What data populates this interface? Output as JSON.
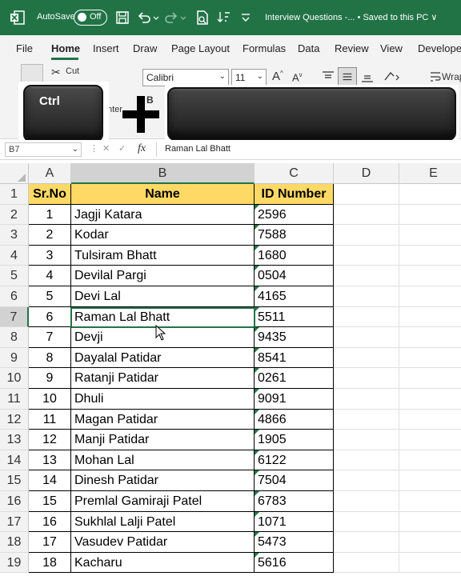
{
  "titlebar": {
    "autosave_label": "AutoSave",
    "autosave_state": "Off",
    "doc_title": "Interview Questions -... • Saved to this PC ∨"
  },
  "tabs": [
    "File",
    "Home",
    "Insert",
    "Draw",
    "Page Layout",
    "Formulas",
    "Data",
    "Review",
    "View",
    "Developer"
  ],
  "active_tab": "Home",
  "ribbon": {
    "cut_label": "Cut",
    "font_name": "Calibri",
    "font_size": "11",
    "grow_font": "A",
    "shrink_font": "A",
    "bold": "B",
    "format_painter_fragment": "nter",
    "wrap_label": "Wrap"
  },
  "keys": {
    "ctrl_label": "Ctrl"
  },
  "formula_bar": {
    "name_box": "B7",
    "fx": "fx",
    "content": "Raman Lal Bhatt"
  },
  "columns": [
    "A",
    "B",
    "C",
    "D",
    "E"
  ],
  "header": {
    "sr": "Sr.No",
    "name": "Name",
    "id": "ID Number"
  },
  "rows": [
    {
      "n": "2",
      "sr": "1",
      "name": "Jagji Katara",
      "id": "2596"
    },
    {
      "n": "3",
      "sr": "2",
      "name": "Kodar",
      "id": "7588"
    },
    {
      "n": "4",
      "sr": "3",
      "name": "Tulsiram Bhatt",
      "id": "1680"
    },
    {
      "n": "5",
      "sr": "4",
      "name": "Devilal Pargi",
      "id": "0504"
    },
    {
      "n": "6",
      "sr": "5",
      "name": "Devi Lal",
      "id": "4165"
    },
    {
      "n": "7",
      "sr": "6",
      "name": "Raman Lal Bhatt",
      "id": "5511"
    },
    {
      "n": "8",
      "sr": "7",
      "name": "Devji",
      "id": "9435"
    },
    {
      "n": "9",
      "sr": "8",
      "name": "Dayalal Patidar",
      "id": "8541"
    },
    {
      "n": "10",
      "sr": "9",
      "name": "Ratanji Patidar",
      "id": "0261"
    },
    {
      "n": "11",
      "sr": "10",
      "name": "Dhuli",
      "id": "9091"
    },
    {
      "n": "12",
      "sr": "11",
      "name": "Magan Patidar",
      "id": "4866"
    },
    {
      "n": "13",
      "sr": "12",
      "name": "Manji Patidar",
      "id": "1905"
    },
    {
      "n": "14",
      "sr": "13",
      "name": "Mohan Lal",
      "id": "6122"
    },
    {
      "n": "15",
      "sr": "14",
      "name": "Dinesh Patidar",
      "id": "7504"
    },
    {
      "n": "16",
      "sr": "15",
      "name": "Premlal Gamiraji Patel",
      "id": "6783"
    },
    {
      "n": "17",
      "sr": "16",
      "name": "Sukhlal Lalji Patel",
      "id": "1071"
    },
    {
      "n": "18",
      "sr": "17",
      "name": "Vasudev Patidar",
      "id": "5473"
    },
    {
      "n": "19",
      "sr": "18",
      "name": "Kacharu",
      "id": "5616"
    }
  ],
  "selected_row": "7",
  "selected_col": "B",
  "colors": {
    "excel_green": "#217346",
    "header_fill": "#ffd966"
  }
}
